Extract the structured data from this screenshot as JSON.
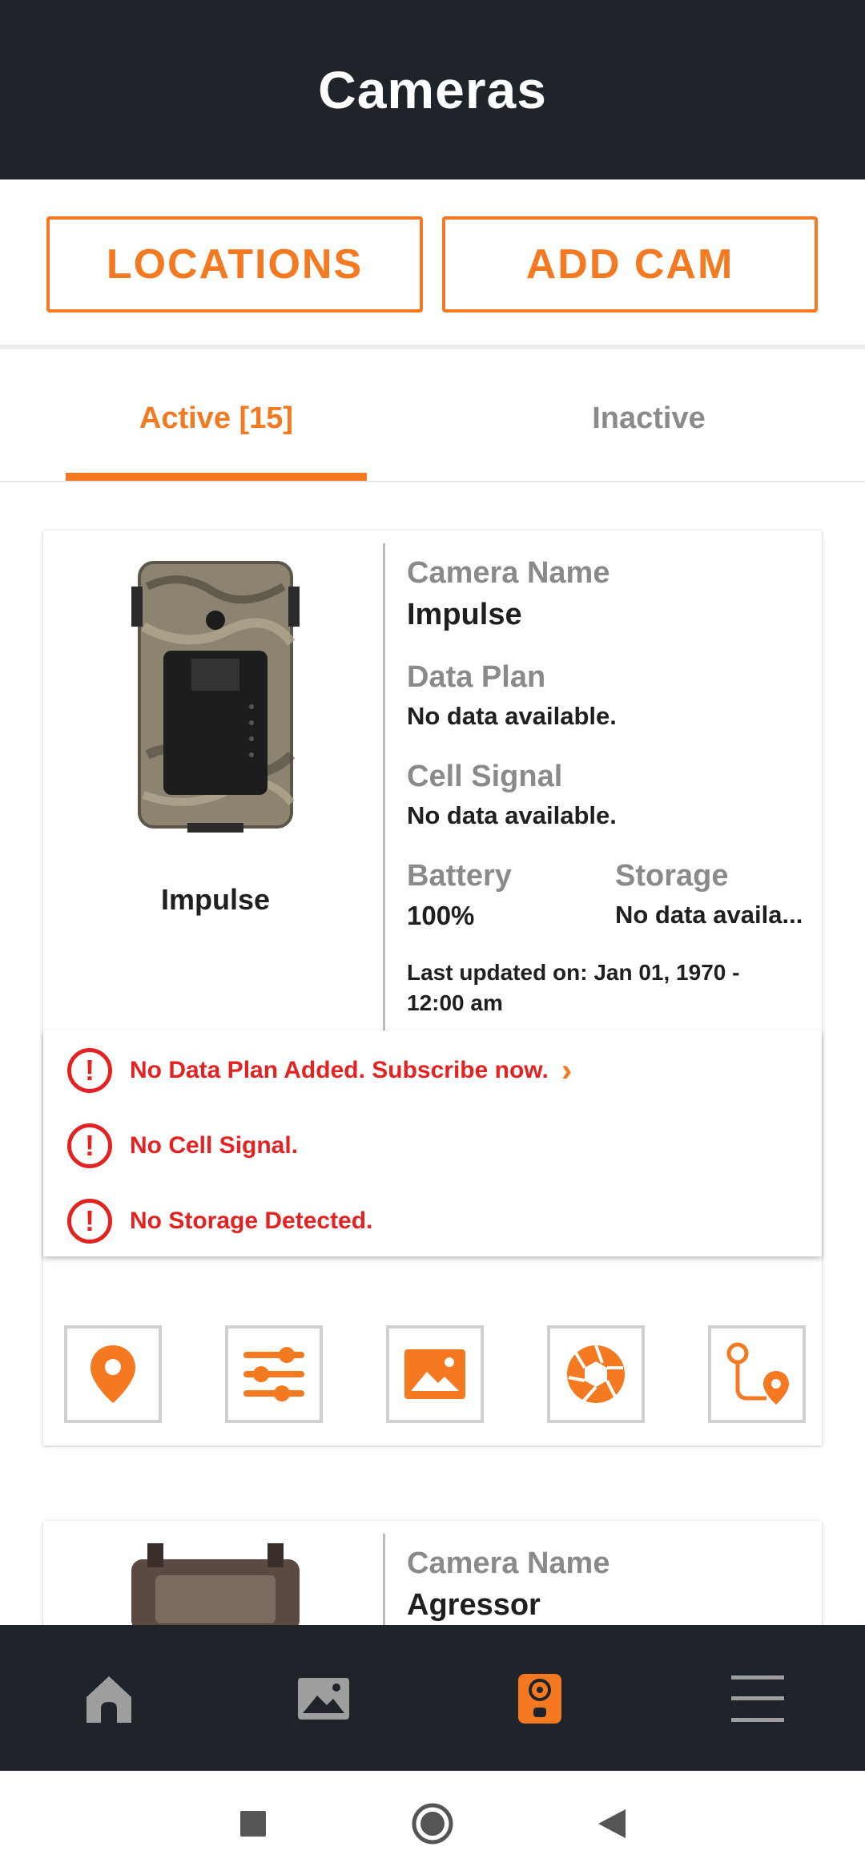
{
  "header": {
    "title": "Cameras"
  },
  "top_buttons": {
    "locations": "LOCATIONS",
    "add_cam": "ADD CAM"
  },
  "tabs": {
    "active": "Active [15]",
    "inactive": "Inactive"
  },
  "cards": [
    {
      "image_caption": "Impulse",
      "camera_name_label": "Camera Name",
      "camera_name": "Impulse",
      "data_plan_label": "Data Plan",
      "data_plan": "No data available.",
      "cell_signal_label": "Cell Signal",
      "cell_signal": "No data available.",
      "battery_label": "Battery",
      "battery": "100%",
      "storage_label": "Storage",
      "storage": "No data availa...",
      "last_updated_line1": "Last updated on: Jan 01, 1970 -",
      "last_updated_line2": "12:00 am",
      "warnings": [
        {
          "text": "No Data Plan Added. Subscribe now."
        },
        {
          "text": "No Cell Signal."
        },
        {
          "text": "No Storage Detected."
        }
      ],
      "actions": [
        "location-pin-icon",
        "settings-sliders-icon",
        "gallery-image-icon",
        "shutter-icon",
        "route-map-icon"
      ]
    },
    {
      "camera_name_label": "Camera Name",
      "camera_name": "Agressor"
    }
  ],
  "bottom_nav": {
    "items": [
      "home-icon",
      "gallery-icon",
      "camera-icon",
      "menu-icon"
    ],
    "active": "camera-icon"
  },
  "colors": {
    "accent": "#f47920",
    "header_bg": "#1f232a",
    "warning": "#e32222",
    "muted": "#8a8a8a"
  }
}
